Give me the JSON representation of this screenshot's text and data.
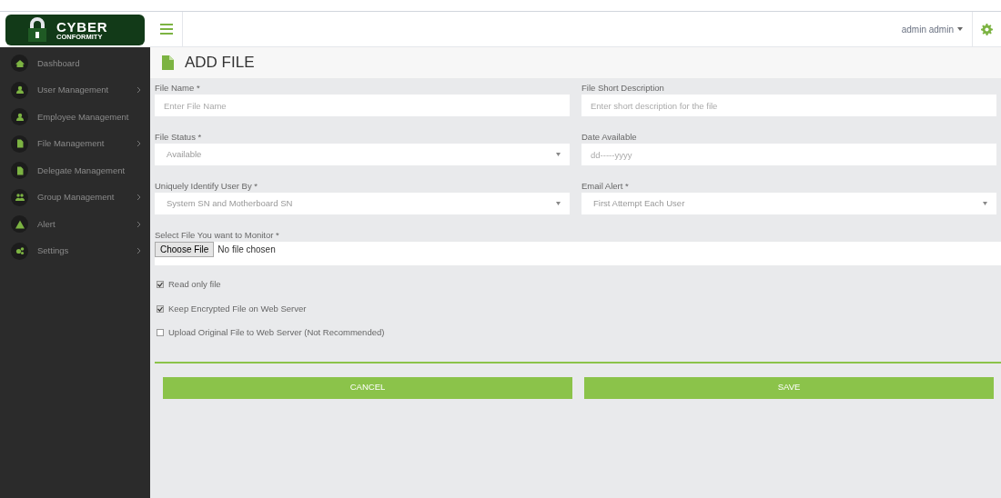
{
  "logo": {
    "title": "CYBER",
    "subtitle": "CONFORMITY"
  },
  "sidebar": {
    "items": [
      {
        "label": "Dashboard",
        "kind": "home",
        "has_submenu": false
      },
      {
        "label": "User Management",
        "kind": "user",
        "has_submenu": true
      },
      {
        "label": "Employee Management",
        "kind": "user",
        "has_submenu": false
      },
      {
        "label": "File Management",
        "kind": "file",
        "has_submenu": true
      },
      {
        "label": "Delegate Management",
        "kind": "file",
        "has_submenu": false
      },
      {
        "label": "Group Management",
        "kind": "group",
        "has_submenu": true
      },
      {
        "label": "Alert",
        "kind": "alert",
        "has_submenu": true
      },
      {
        "label": "Settings",
        "kind": "cogs",
        "has_submenu": true
      }
    ]
  },
  "topbar": {
    "user": "admin admin"
  },
  "page_title": "ADD FILE",
  "form": {
    "rows": [
      [
        {
          "kind": "text",
          "label": "File Name *",
          "placeholder": "Enter File Name"
        },
        {
          "kind": "text",
          "label": "File Short Description",
          "placeholder": "Enter short description for the file"
        }
      ],
      [
        {
          "kind": "select",
          "label": "File Status *",
          "value": "Available"
        },
        {
          "kind": "date",
          "label": "Date Available",
          "placeholder": "dd-----yyyy"
        }
      ],
      [
        {
          "kind": "select",
          "label": "Uniquely Identify User By *",
          "value": "System SN and Motherboard SN"
        },
        {
          "kind": "select",
          "label": "Email Alert *",
          "value": "First Attempt Each User"
        }
      ]
    ],
    "file_picker": {
      "label": "Select File You want to Monitor *",
      "button": "Choose File",
      "status": "No file chosen"
    },
    "checkboxes": [
      {
        "label": "Read only file",
        "checked": true
      },
      {
        "label": "Keep Encrypted File on Web Server",
        "checked": true
      },
      {
        "label": "Upload Original File to Web Server (Not Recommended)",
        "checked": false
      }
    ],
    "buttons": [
      "CANCEL",
      "SAVE"
    ]
  }
}
